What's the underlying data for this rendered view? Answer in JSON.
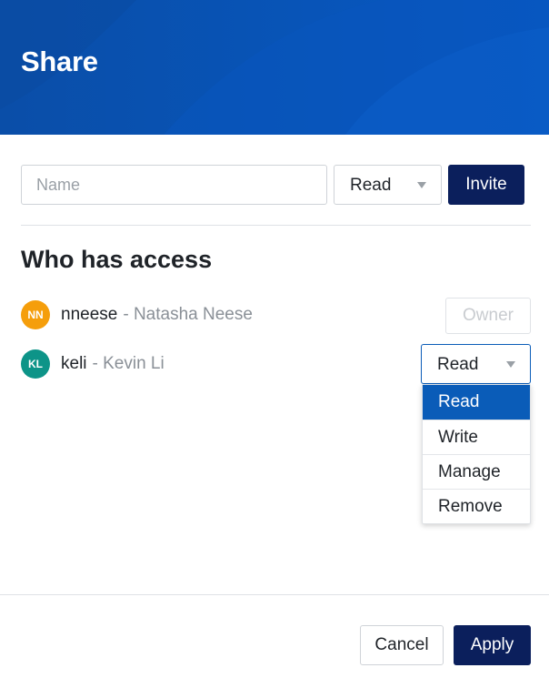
{
  "header": {
    "title": "Share",
    "background_color": "#0a4fb0"
  },
  "invite": {
    "name_placeholder": "Name",
    "name_value": "",
    "permission": "Read",
    "invite_label": "Invite"
  },
  "access": {
    "title": "Who has access",
    "users": [
      {
        "initials": "NN",
        "username": "nneese",
        "fullname": "- Natasha Neese",
        "avatar_color": "#f59e0b",
        "role": "Owner"
      },
      {
        "initials": "KL",
        "username": "keli",
        "fullname": "- Kevin Li",
        "avatar_color": "#0d9488",
        "role": "Read"
      }
    ]
  },
  "dropdown": {
    "options": [
      "Read",
      "Write",
      "Manage",
      "Remove"
    ],
    "selected": "Read",
    "selected_color": "#0a5cb8"
  },
  "footer": {
    "cancel_label": "Cancel",
    "apply_label": "Apply",
    "primary_color": "#0b1f5c"
  }
}
